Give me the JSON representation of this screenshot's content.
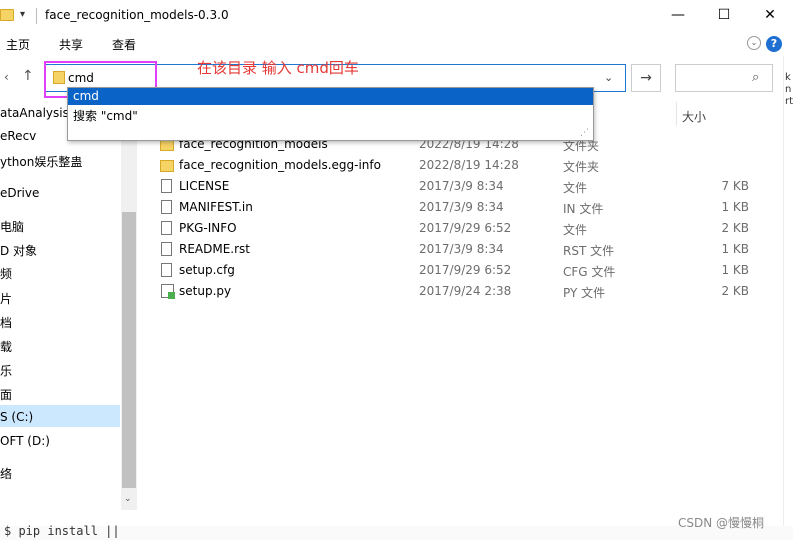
{
  "window": {
    "title": "face_recognition_models-0.3.0",
    "qat_arrow": "▾",
    "minimize": "—",
    "maximize": "☐",
    "close": "✕"
  },
  "ribbon": {
    "tabs": [
      "主页",
      "共享",
      "查看"
    ],
    "help": "?"
  },
  "address": {
    "value": "cmd",
    "annotation": "在该目录  输入 cmd回车"
  },
  "autocomplete": {
    "items": [
      "cmd",
      "搜索 \"cmd\""
    ]
  },
  "sidebar": {
    "items": [
      "ataAnalysis",
      "eRecv",
      "ython娱乐整蛊",
      "eDrive",
      "电脑",
      "D 对象",
      "频",
      "片",
      "档",
      "载",
      "乐",
      "面",
      "S (C:)",
      "OFT (D:)",
      "络"
    ]
  },
  "columns": {
    "size": "大小"
  },
  "files": [
    {
      "name": "face_recognition_models",
      "date": "2022/8/19 14:28",
      "type": "文件夹",
      "size": "",
      "icon": "folder-icon"
    },
    {
      "name": "face_recognition_models.egg-info",
      "date": "2022/8/19 14:28",
      "type": "文件夹",
      "size": "",
      "icon": "folder-icon"
    },
    {
      "name": "LICENSE",
      "date": "2017/3/9 8:34",
      "type": "文件",
      "size": "7 KB",
      "icon": "file-icon"
    },
    {
      "name": "MANIFEST.in",
      "date": "2017/3/9 8:34",
      "type": "IN 文件",
      "size": "1 KB",
      "icon": "file-icon"
    },
    {
      "name": "PKG-INFO",
      "date": "2017/9/29 6:52",
      "type": "文件",
      "size": "2 KB",
      "icon": "file-icon"
    },
    {
      "name": "README.rst",
      "date": "2017/3/9 8:34",
      "type": "RST 文件",
      "size": "1 KB",
      "icon": "file-icon"
    },
    {
      "name": "setup.cfg",
      "date": "2017/9/29 6:52",
      "type": "CFG 文件",
      "size": "1 KB",
      "icon": "file-icon"
    },
    {
      "name": "setup.py",
      "date": "2017/9/24 2:38",
      "type": "PY 文件",
      "size": "2 KB",
      "icon": "python-file-icon"
    }
  ],
  "bottom": {
    "terminal": "$ pip install ||",
    "watermark": "CSDN @慢慢桐"
  },
  "right_edge": "k\nn\nrt"
}
